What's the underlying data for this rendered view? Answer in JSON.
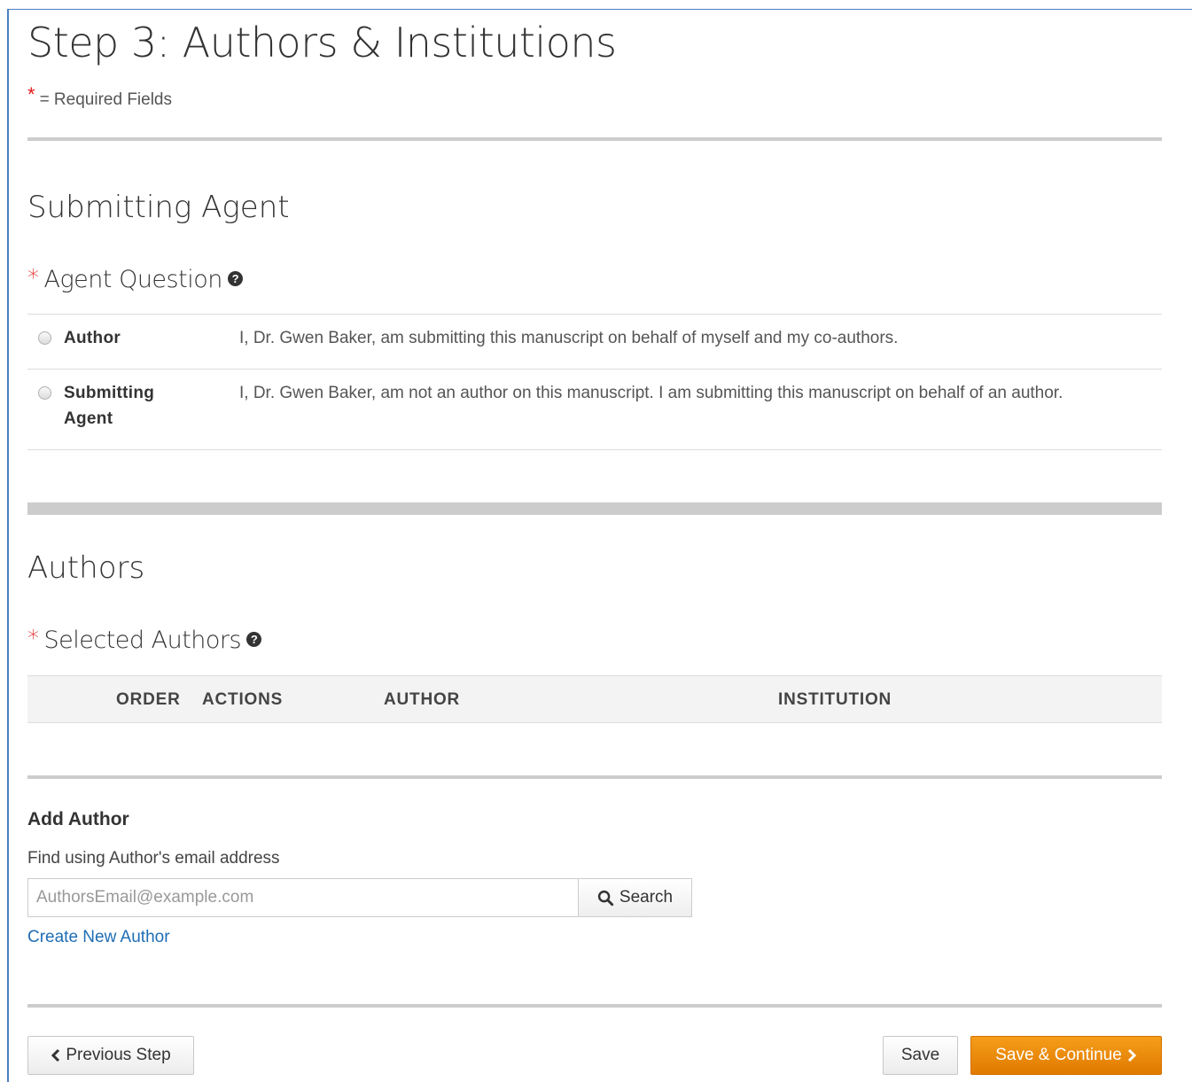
{
  "page": {
    "title": "Step 3: Authors & Institutions",
    "required_note": "= Required Fields"
  },
  "submitting_agent": {
    "section_title": "Submitting Agent",
    "question": "Agent Question",
    "options": [
      {
        "label": "Author",
        "description": "I, Dr. Gwen Baker, am submitting this manuscript on behalf of myself and my co-authors."
      },
      {
        "label": "Submitting Agent",
        "description": "I, Dr. Gwen Baker, am not an author on this manuscript. I am submitting this manuscript on behalf of an author."
      }
    ]
  },
  "authors": {
    "section_title": "Authors",
    "question": "Selected Authors",
    "columns": [
      "ORDER",
      "ACTIONS",
      "AUTHOR",
      "INSTITUTION"
    ]
  },
  "add_author": {
    "title": "Add Author",
    "find_label": "Find using Author's email address",
    "email_placeholder": "AuthorsEmail@example.com",
    "search_label": "Search",
    "create_link": "Create New Author"
  },
  "footer": {
    "previous_label": "Previous Step",
    "save_label": "Save",
    "save_continue_label": "Save & Continue"
  },
  "colors": {
    "required_star": "#e01a1a",
    "link": "#1f6db4",
    "primary_button": "#f08c00",
    "frame_border": "#4a7fbf"
  }
}
